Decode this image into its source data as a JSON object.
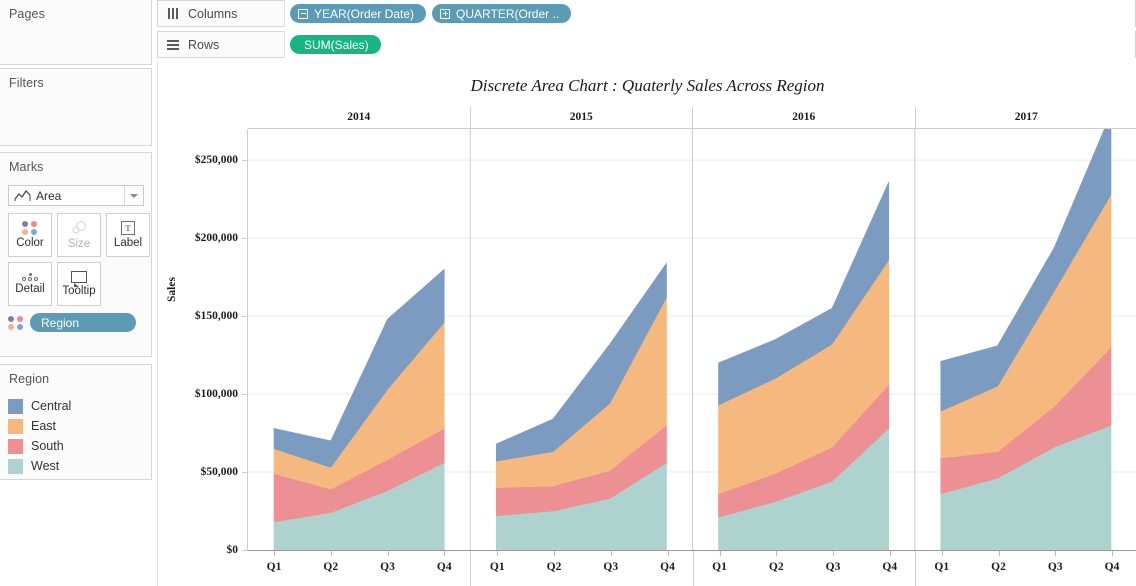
{
  "window": {
    "app": "Tableau"
  },
  "panels": {
    "pages": {
      "title": "Pages"
    },
    "filters": {
      "title": "Filters"
    },
    "marks": {
      "title": "Marks",
      "mark_type": "Area",
      "mark_type_icon": "area-chart-icon",
      "buttons": [
        {
          "name": "color",
          "label": "Color",
          "icon": "color-dots-icon",
          "disabled": false
        },
        {
          "name": "size",
          "label": "Size",
          "icon": "size-circles-icon",
          "disabled": true
        },
        {
          "name": "label",
          "label": "Label",
          "icon": "label-t-icon",
          "disabled": false
        },
        {
          "name": "detail",
          "label": "Detail",
          "icon": "detail-dots-icon",
          "disabled": false
        },
        {
          "name": "tooltip",
          "label": "Tooltip",
          "icon": "tooltip-bubble-icon",
          "disabled": false
        }
      ],
      "pills": [
        {
          "label": "Region",
          "color": "#5b9bb5",
          "icon": "color-dots-icon"
        }
      ]
    },
    "legend": {
      "title": "Region",
      "items": [
        {
          "label": "Central",
          "color": "#7b9cc0"
        },
        {
          "label": "East",
          "color": "#f5b97f"
        },
        {
          "label": "South",
          "color": "#ec9093"
        },
        {
          "label": "West",
          "color": "#aed3cf"
        }
      ]
    }
  },
  "shelves": {
    "columns": {
      "label": "Columns",
      "icon": "columns-icon",
      "pills": [
        {
          "label": "YEAR(Order Date)",
          "sign": "minus",
          "color": "#5b9bb5"
        },
        {
          "label": "QUARTER(Order ..",
          "sign": "plus",
          "color": "#5b9bb5"
        }
      ]
    },
    "rows": {
      "label": "Rows",
      "icon": "rows-icon",
      "pills": [
        {
          "label": "SUM(Sales)",
          "sign": "none",
          "color": "#17b582"
        }
      ]
    }
  },
  "chart_data": {
    "type": "area",
    "title": "Discrete Area Chart : Quaterly Sales Across Region",
    "xlabel": "",
    "ylabel": "Sales",
    "stacked": true,
    "legend_position": "left",
    "grid": true,
    "ylim": [
      0,
      270000
    ],
    "yticks": [
      0,
      50000,
      100000,
      150000,
      200000,
      250000
    ],
    "ytick_labels": [
      "$0",
      "$50,000",
      "$100,000",
      "$150,000",
      "$200,000",
      "$250,000"
    ],
    "panels": [
      "2014",
      "2015",
      "2016",
      "2017"
    ],
    "categories": [
      "Q1",
      "Q2",
      "Q3",
      "Q4"
    ],
    "series": [
      {
        "name": "West",
        "color": "#aed3cf",
        "values": {
          "2014": [
            18000,
            24000,
            38000,
            56000
          ],
          "2015": [
            22000,
            25000,
            33000,
            56000
          ],
          "2016": [
            21000,
            31000,
            44000,
            78000
          ],
          "2017": [
            36000,
            46000,
            66000,
            80000
          ]
        }
      },
      {
        "name": "South",
        "color": "#ec9093",
        "values": {
          "2014": [
            31000,
            15000,
            20000,
            22000
          ],
          "2015": [
            18000,
            16000,
            18000,
            24000
          ],
          "2016": [
            15000,
            18000,
            22000,
            28000
          ],
          "2017": [
            23000,
            17000,
            26000,
            50000
          ]
        }
      },
      {
        "name": "East",
        "color": "#f5b97f",
        "values": {
          "2014": [
            16000,
            14000,
            45000,
            68000
          ],
          "2015": [
            17000,
            22000,
            43000,
            82000
          ],
          "2016": [
            57000,
            61000,
            66000,
            80000
          ],
          "2017": [
            30000,
            42000,
            74000,
            98000
          ]
        }
      },
      {
        "name": "Central",
        "color": "#7b9cc0",
        "values": {
          "2014": [
            13000,
            17000,
            45000,
            34000
          ],
          "2015": [
            11000,
            21000,
            38000,
            22000
          ],
          "2016": [
            27000,
            25000,
            23000,
            50000
          ],
          "2017": [
            32000,
            26000,
            28000,
            52000
          ]
        }
      }
    ]
  }
}
